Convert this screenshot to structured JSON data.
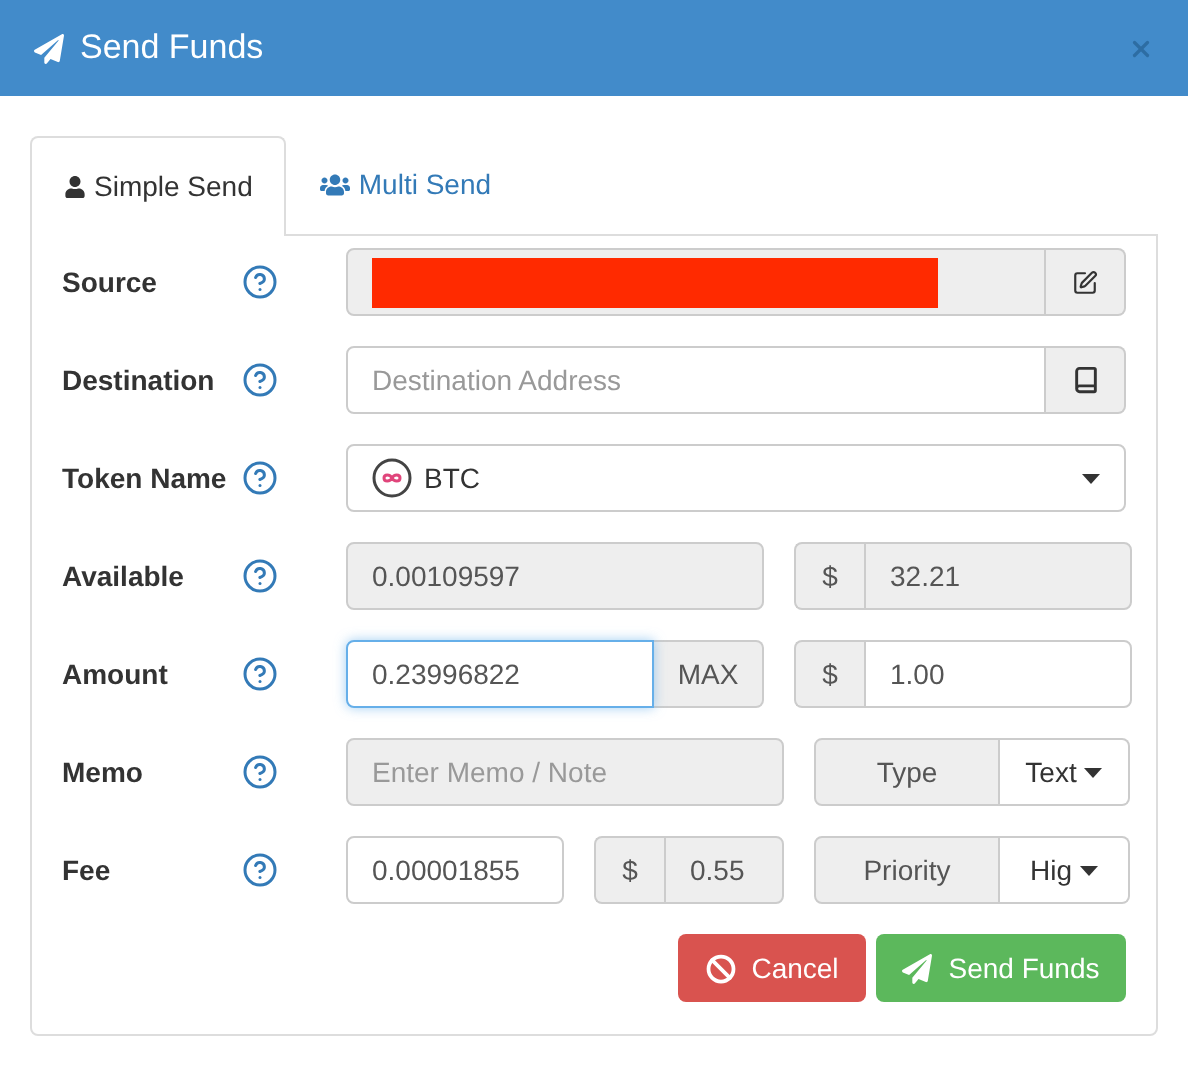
{
  "dialog": {
    "title": "Send Funds"
  },
  "tabs": [
    {
      "label": "Simple Send",
      "kind": "single",
      "selected": true
    },
    {
      "label": "Multi Send",
      "kind": "multi",
      "selected": false
    }
  ],
  "rows": [
    {
      "kind": "source",
      "label": "Source",
      "disabled": true
    },
    {
      "kind": "destination",
      "label": "Destination",
      "placeholder": "Destination Address"
    },
    {
      "kind": "token",
      "label": "Token Name",
      "value": "BTC"
    },
    {
      "kind": "available",
      "label": "Available",
      "value": "0.00109597",
      "disabled": true,
      "currency": "$",
      "fiat": "32.21"
    },
    {
      "kind": "amount",
      "label": "Amount",
      "value": "0.23996822",
      "focused": true,
      "max": "MAX",
      "currency": "$",
      "fiat": "1.00"
    },
    {
      "kind": "memo",
      "label": "Memo",
      "placeholder": "Enter Memo / Note",
      "disabled": true,
      "type_label": "Type",
      "type_value": "Text"
    },
    {
      "kind": "fee",
      "label": "Fee",
      "value": "0.00001855",
      "currency": "$",
      "fiat": "0.55",
      "priority_label": "Priority",
      "priority_value": "Hig"
    }
  ],
  "buttons": [
    {
      "label": "Cancel",
      "kind": "cancel"
    },
    {
      "label": "Send Funds",
      "kind": "send"
    }
  ]
}
